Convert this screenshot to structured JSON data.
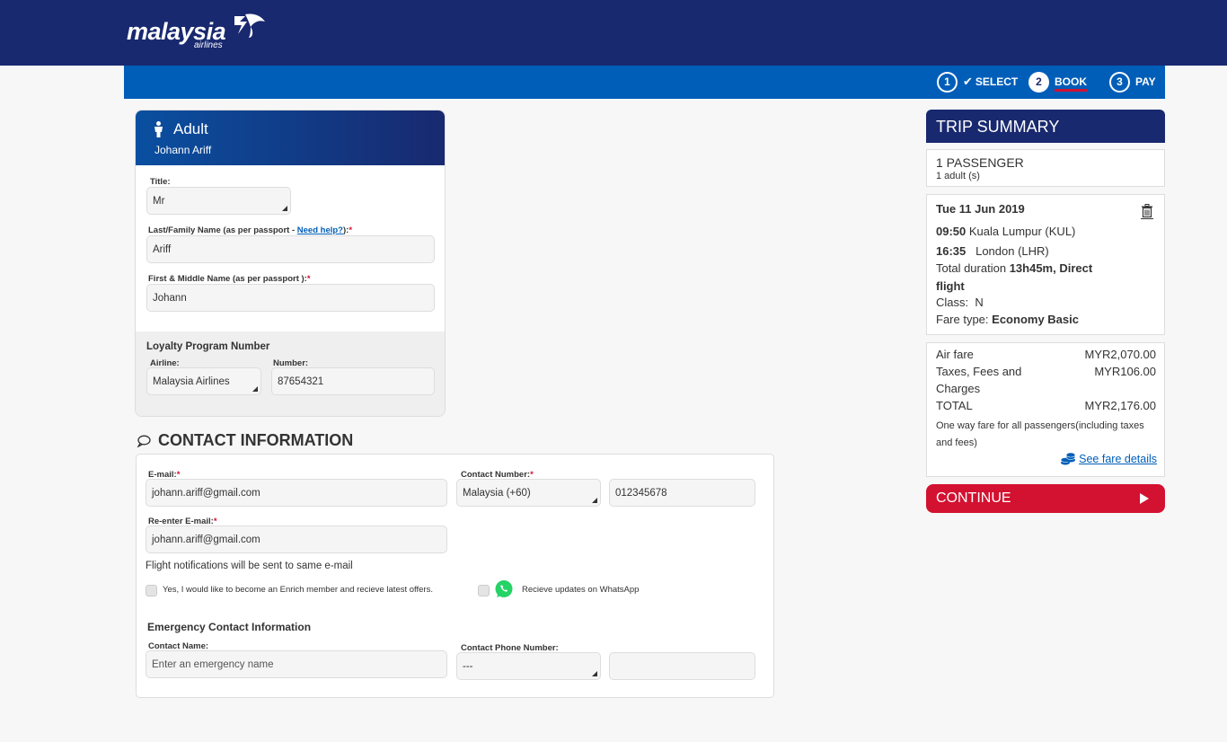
{
  "header": {
    "logo_text": "malaysia",
    "logo_subtext": "airlines"
  },
  "steps": [
    {
      "number": "1",
      "label": "SELECT",
      "state": "completed"
    },
    {
      "number": "2",
      "label": "BOOK",
      "state": "active"
    },
    {
      "number": "3",
      "label": "PAY",
      "state": "pending"
    }
  ],
  "passenger": {
    "type": "Adult",
    "name": "Johann Ariff",
    "title_label": "Title:",
    "title_value": "Mr",
    "last_name_label": "Last/Family Name (as per passport - ",
    "help_link": "Need help?",
    "last_name_label_suffix": "):",
    "last_name_value": "Ariff",
    "first_name_label": "First & Middle Name (as per passport ):",
    "first_name_value": "Johann",
    "required_mark": "*",
    "loyalty": {
      "title": "Loyalty Program Number",
      "airline_label": "Airline:",
      "airline_value": "Malaysia Airlines",
      "number_label": "Number:",
      "number_value": "87654321"
    }
  },
  "contact": {
    "title": "CONTACT INFORMATION",
    "email_label": "E-mail:",
    "email_value": "johann.ariff@gmail.com",
    "reenter_label": "Re-enter E-mail:",
    "reenter_value": "johann.ariff@gmail.com",
    "number_label": "Contact Number:",
    "country_value": "Malaysia (+60)",
    "phone_value": "012345678",
    "notification_note": "Flight notifications will be sent to same e-mail",
    "enrich_label": "Yes, I would like to become an Enrich member and recieve latest offers.",
    "enrich_checked": false,
    "whatsapp_label": "Recieve updates on WhatsApp",
    "whatsapp_checked": false,
    "emergency": {
      "title": "Emergency Contact Information",
      "name_label": "Contact Name:",
      "name_placeholder": "Enter an emergency name",
      "phone_label": "Contact Phone Number:",
      "phone_country_value": "---",
      "phone_value": ""
    }
  },
  "summary": {
    "title": "TRIP SUMMARY",
    "passenger_count": "1 PASSENGER",
    "passenger_detail": "1 adult (s)",
    "flight": {
      "date": "Tue 11 Jun 2019",
      "depart_time": "09:50",
      "depart_place": "Kuala Lumpur (KUL)",
      "arrive_time": "16:35",
      "arrive_place": "London (LHR)",
      "duration_label": "Total  duration",
      "duration_value": "13h45m, Direct",
      "duration_value_2": "flight",
      "class_label": "Class:",
      "class_value": "N",
      "fare_type_label": "Fare type:",
      "fare_type_value": "Economy Basic"
    },
    "fare": {
      "air_fare_label": "Air fare",
      "air_fare_value": "MYR2,070.00",
      "taxes_label_1": "Taxes, Fees and",
      "taxes_label_2": "Charges",
      "taxes_value": "MYR106.00",
      "total_label": "TOTAL",
      "total_value": "MYR2,176.00",
      "note": "One way fare for all passengers(including taxes and fees)",
      "details_link": "See fare details"
    },
    "continue_label": "CONTINUE"
  },
  "colors": {
    "navy": "#19296f",
    "blue": "#005eb8",
    "red": "#d31130",
    "whatsapp_green": "#25d366"
  }
}
